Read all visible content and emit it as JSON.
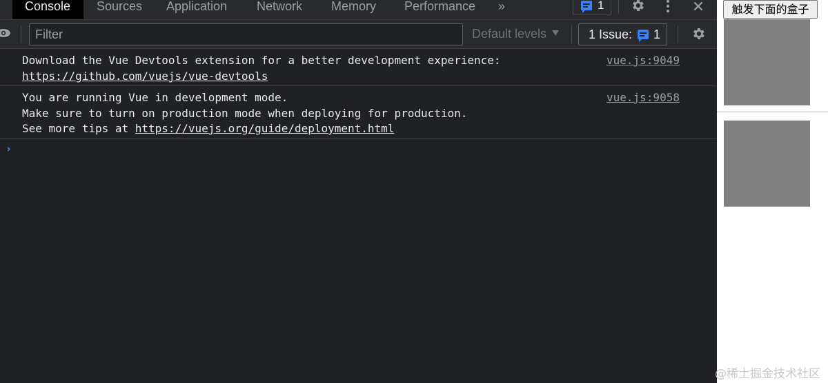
{
  "devtools": {
    "tabs": [
      {
        "label": "Console",
        "active": true
      },
      {
        "label": "Sources"
      },
      {
        "label": "Application"
      },
      {
        "label": "Network"
      },
      {
        "label": "Memory"
      },
      {
        "label": "Performance"
      }
    ],
    "more_tabs_label": "»",
    "message_count": "1",
    "close_label": "✕",
    "toolbar": {
      "filter_placeholder": "Filter",
      "levels_label": "Default levels",
      "issues_label": "1 Issue:",
      "issues_count": "1"
    },
    "messages": [
      {
        "line1": "Download the Vue Devtools extension for a better development experience:",
        "link": "https://github.com/vuejs/vue-devtools",
        "source": "vue.js:9049"
      },
      {
        "line1": "You are running Vue in development mode.",
        "line2": "Make sure to turn on production mode when deploying for production.",
        "line3_prefix": "See more tips at ",
        "link": "https://vuejs.org/guide/deployment.html",
        "source": "vue.js:9058"
      }
    ],
    "prompt_symbol": "›",
    "colors": {
      "panel_bg": "#202124",
      "toolbar_bg": "#292a2d",
      "accent_blue": "#3b82f6",
      "text": "#e8eaed",
      "muted": "#9aa0a6"
    }
  },
  "page": {
    "button_label": "触发下面的盒子",
    "box_color": "#808080",
    "watermark": "@稀土掘金技术社区"
  }
}
